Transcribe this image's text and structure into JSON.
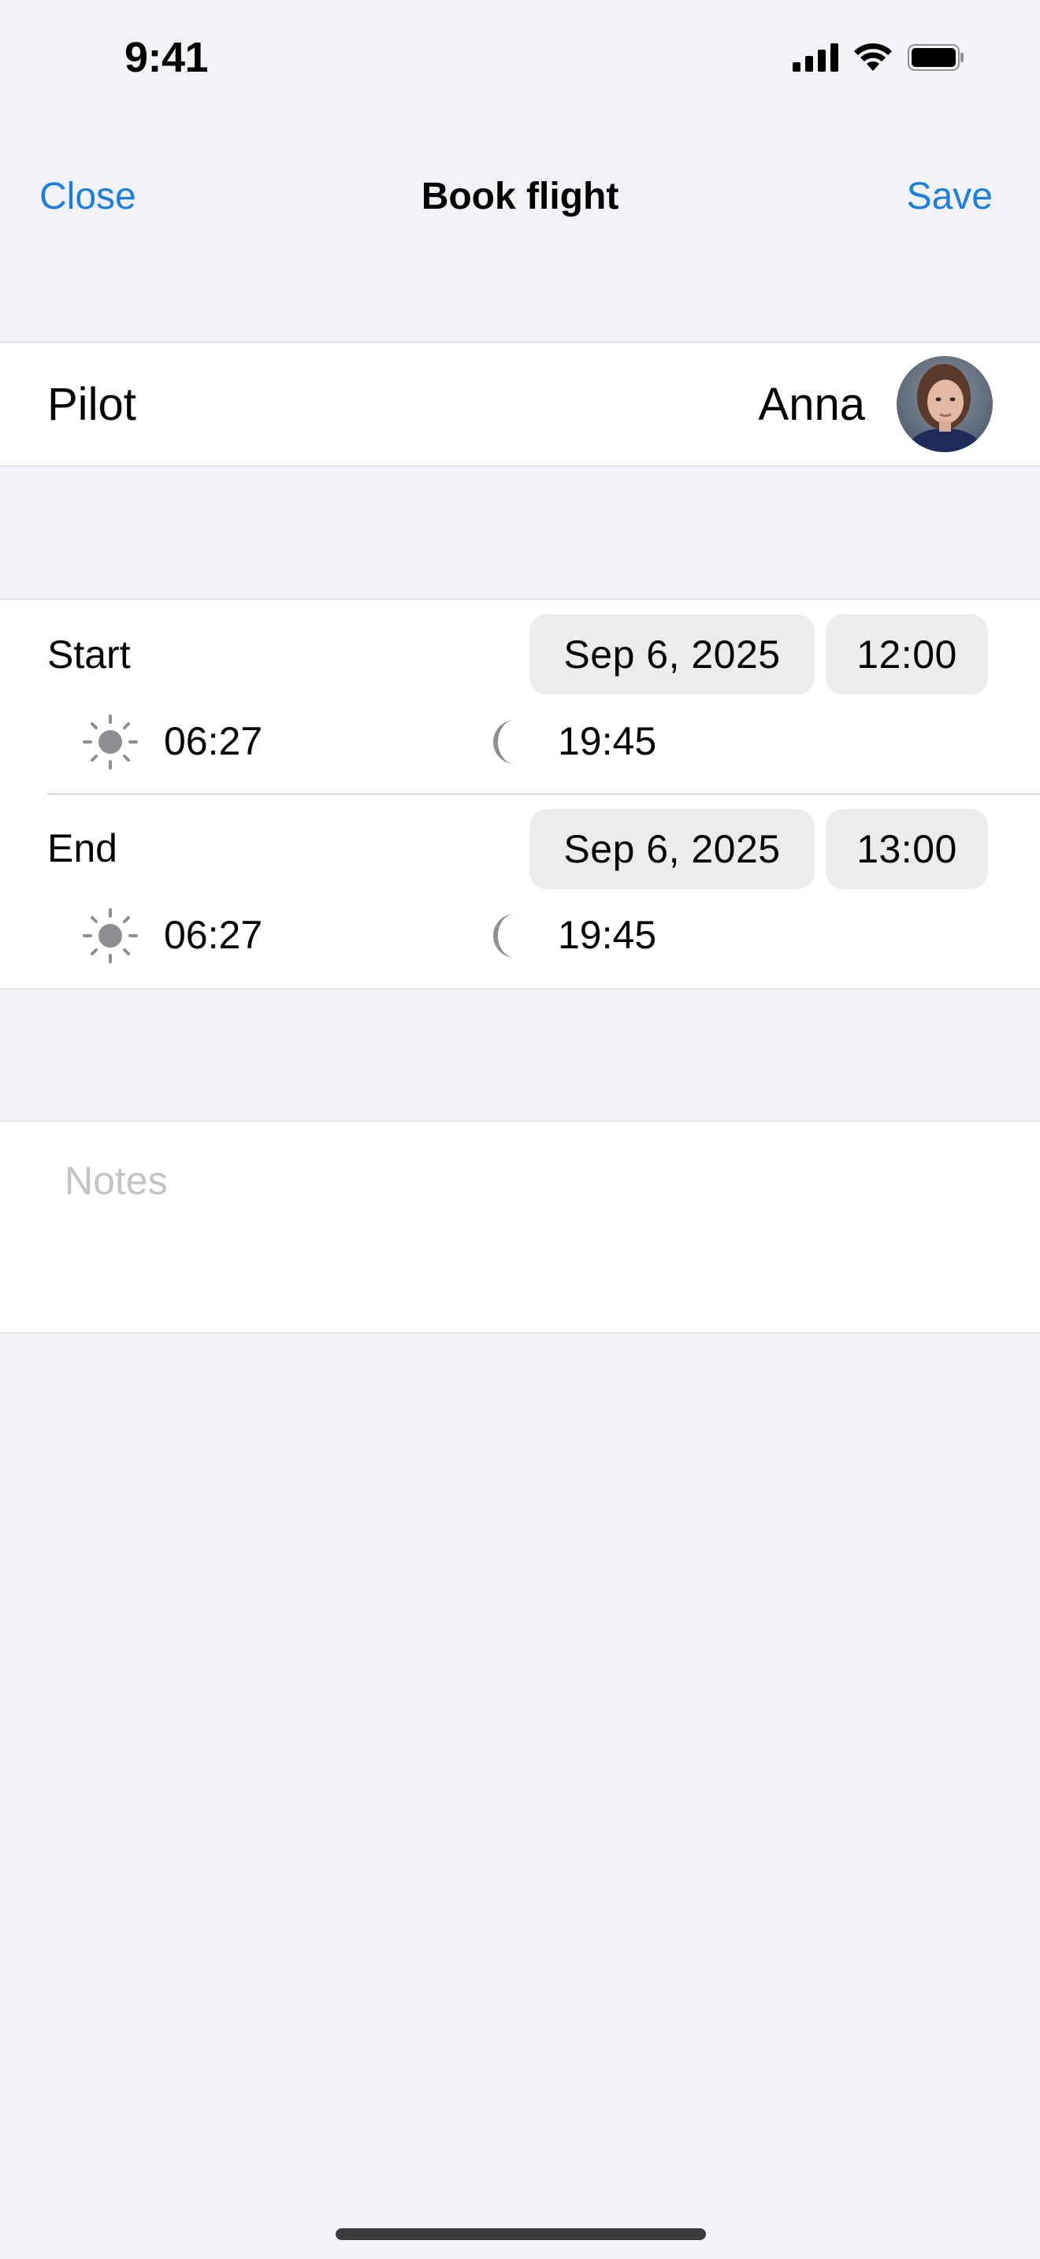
{
  "status_bar": {
    "time": "9:41",
    "icons": [
      "cellular-signal-icon",
      "wifi-icon",
      "battery-icon"
    ]
  },
  "nav": {
    "close_label": "Close",
    "title": "Book flight",
    "save_label": "Save",
    "accent_color": "#1a7fe0"
  },
  "pilot": {
    "label": "Pilot",
    "name": "Anna"
  },
  "start": {
    "label": "Start",
    "date": "Sep 6, 2025",
    "time": "12:00",
    "sunrise": "06:27",
    "sunset": "19:45"
  },
  "end": {
    "label": "End",
    "date": "Sep 6, 2025",
    "time": "13:00",
    "sunrise": "06:27",
    "sunset": "19:45"
  },
  "notes": {
    "placeholder": "Notes",
    "value": ""
  }
}
